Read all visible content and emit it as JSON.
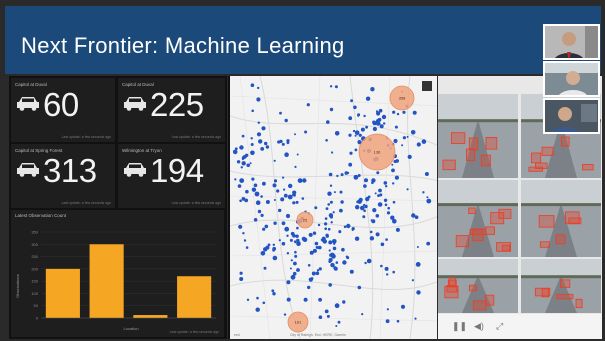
{
  "banner": {
    "title": "Next Frontier: Machine Learning"
  },
  "counters": [
    {
      "location": "Capitol at Duval",
      "count": "60",
      "footer": "Last update: a few seconds ago"
    },
    {
      "location": "Capitol at Duval",
      "count": "225",
      "footer": "Last update: a few seconds ago"
    },
    {
      "location": "Capitol at Spring Forest",
      "count": "313",
      "footer": "Last update: a few seconds ago"
    },
    {
      "location": "Wilmington at Tryon",
      "count": "194",
      "footer": "Last update: a few seconds ago"
    }
  ],
  "bar_chart": {
    "title": "Latest Observation Count",
    "xlabel": "Location",
    "ylabel": "Observations",
    "footer": "Last update: a few seconds ago"
  },
  "chart_data": {
    "type": "bar",
    "title": "Latest Observation Count",
    "categories": [
      "",
      "",
      "",
      ""
    ],
    "values": [
      200,
      300,
      12,
      170
    ],
    "xlabel": "Location",
    "ylabel": "Observations",
    "ylim": [
      0,
      350
    ],
    "bar_color": "#f5a623",
    "grid": true
  },
  "map": {
    "attribution": "City of Raleigh, Esri, HERE, Garmin",
    "logo": "esri",
    "clusters": [
      "358",
      "136",
      "25",
      "161"
    ]
  },
  "camera_controls": {
    "pause": "❚❚",
    "volume": "◀)",
    "fullscreen": "⤢"
  },
  "colors": {
    "banner": "#1b4a7a",
    "accent_bar": "#f5a623",
    "cluster": "#f0a37c",
    "point": "#2354c4",
    "detection_box": "#e8422a"
  }
}
